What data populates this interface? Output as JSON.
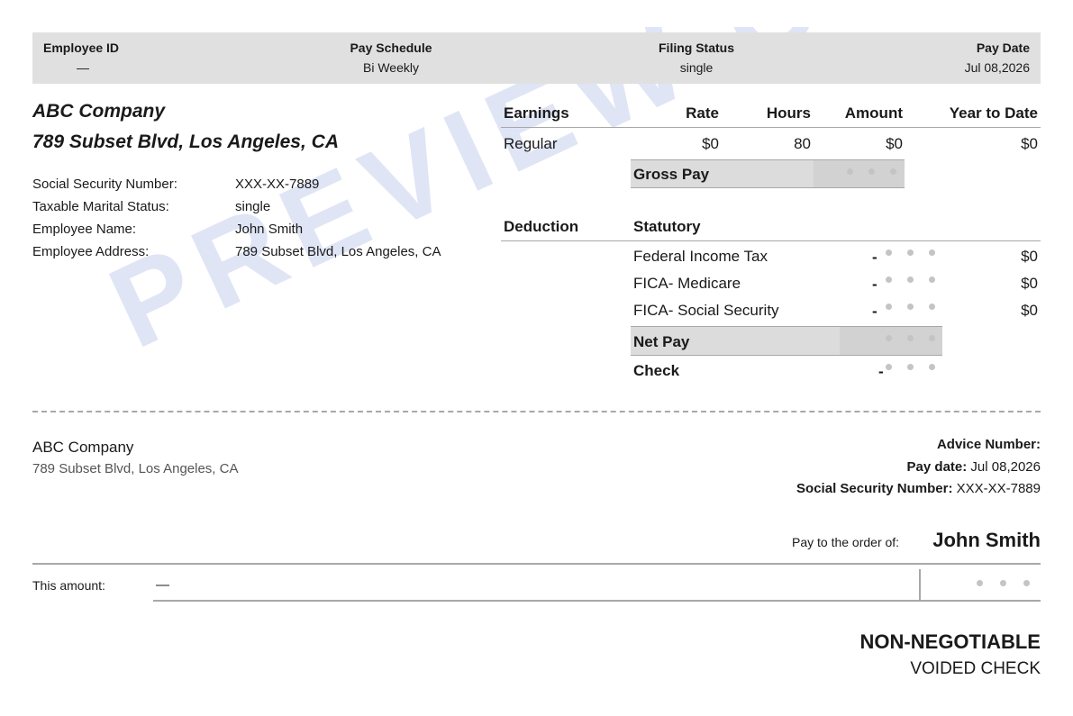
{
  "watermark": "PREVIEW ONLY",
  "header": {
    "employee_id_label": "Employee ID",
    "employee_id_value": "—",
    "pay_schedule_label": "Pay Schedule",
    "pay_schedule_value": "Bi Weekly",
    "filing_status_label": "Filing Status",
    "filing_status_value": "single",
    "pay_date_label": "Pay Date",
    "pay_date_value": "Jul 08,2026"
  },
  "company": {
    "name": "ABC Company",
    "address": "789 Subset Blvd, Los Angeles, CA"
  },
  "employee_info": [
    {
      "label": "Social Security Number:",
      "value": "XXX-XX-7889"
    },
    {
      "label": "Taxable Marital Status:",
      "value": "single"
    },
    {
      "label": "Employee Name:",
      "value": "John Smith"
    },
    {
      "label": "Employee Address:",
      "value": "789 Subset Blvd, Los Angeles, CA"
    }
  ],
  "earnings": {
    "headers": {
      "earnings": "Earnings",
      "rate": "Rate",
      "hours": "Hours",
      "amount": "Amount",
      "ytd": "Year to Date"
    },
    "rows": [
      {
        "name": "Regular",
        "rate": "$0",
        "hours": "80",
        "amount": "$0",
        "ytd": "$0"
      }
    ],
    "gross_pay_label": "Gross Pay"
  },
  "deductions": {
    "deduction_label": "Deduction",
    "statutory_label": "Statutory",
    "rows": [
      {
        "name": "Federal Income Tax",
        "sign": "-",
        "ytd": "$0"
      },
      {
        "name": "FICA- Medicare",
        "sign": "-",
        "ytd": "$0"
      },
      {
        "name": "FICA- Social Security",
        "sign": "-",
        "ytd": "$0"
      }
    ],
    "net_pay_label": "Net Pay",
    "check_label": "Check",
    "check_sign": "-"
  },
  "stub": {
    "company_name": "ABC Company",
    "company_address": "789 Subset Blvd, Los Angeles, CA",
    "advice_number_label": "Advice Number:",
    "advice_number_value": "",
    "pay_date_label": "Pay date:",
    "pay_date_value": "Jul 08,2026",
    "ssn_label": "Social Security Number:",
    "ssn_value": "XXX-XX-7889",
    "pay_to_label": "Pay to the order of:",
    "payee": "John Smith",
    "amount_label": "This amount:",
    "amount_words": "—",
    "non_negotiable": "NON-NEGOTIABLE",
    "voided": "VOIDED CHECK"
  }
}
